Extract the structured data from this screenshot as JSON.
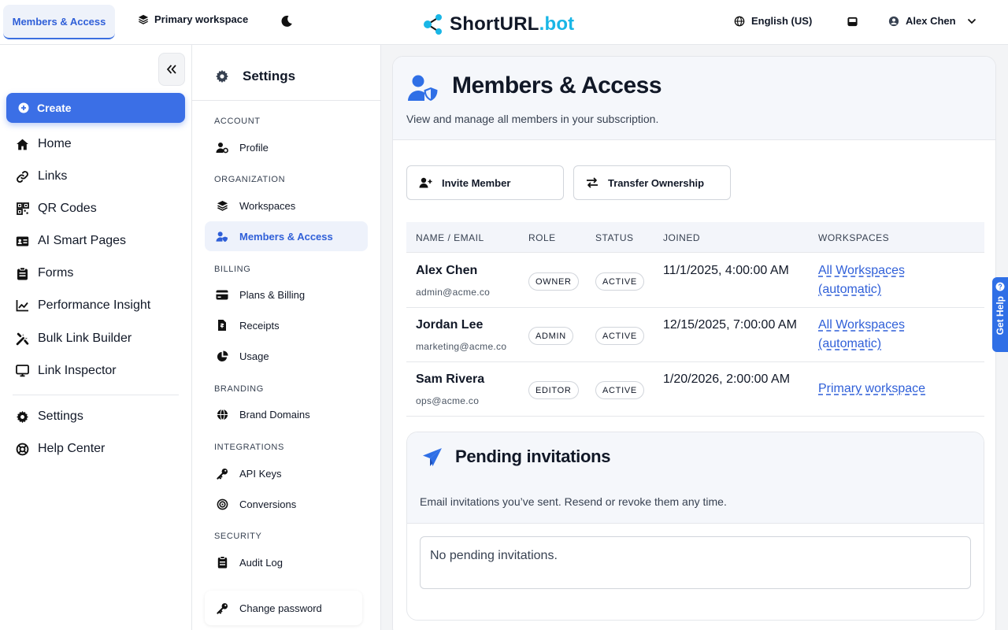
{
  "topbar": {
    "active_tab": "Members & Access",
    "workspace": "Primary workspace",
    "brand_main": "ShortURL",
    "brand_accent": ".bot",
    "language": "English (US)",
    "user": "Alex Chen"
  },
  "leftnav": {
    "create": "Create",
    "items": [
      {
        "label": "Home",
        "icon": "home-icon"
      },
      {
        "label": "Links",
        "icon": "link-icon"
      },
      {
        "label": "QR Codes",
        "icon": "qr-code-icon"
      },
      {
        "label": "AI Smart Pages",
        "icon": "id-card-icon"
      },
      {
        "label": "Forms",
        "icon": "clipboard-icon"
      },
      {
        "label": "Performance Insight",
        "icon": "chart-line-icon"
      },
      {
        "label": "Bulk Link Builder",
        "icon": "tools-icon"
      },
      {
        "label": "Link Inspector",
        "icon": "monitor-icon"
      }
    ],
    "bottom": [
      {
        "label": "Settings",
        "icon": "gear-icon"
      },
      {
        "label": "Help Center",
        "icon": "lifebuoy-icon"
      }
    ]
  },
  "settings": {
    "title": "Settings",
    "sections": {
      "account": "ACCOUNT",
      "organization": "ORGANIZATION",
      "billing": "BILLING",
      "branding": "BRANDING",
      "integrations": "INTEGRATIONS",
      "security": "SECURITY"
    },
    "items": {
      "profile": "Profile",
      "workspaces": "Workspaces",
      "members": "Members & Access",
      "plans": "Plans & Billing",
      "receipts": "Receipts",
      "usage": "Usage",
      "domains": "Brand Domains",
      "api": "API Keys",
      "conversions": "Conversions",
      "audit": "Audit Log",
      "password": "Change password"
    }
  },
  "main": {
    "title": "Members & Access",
    "subtitle": "View and manage all members in your subscription.",
    "invite": "Invite Member",
    "transfer": "Transfer Ownership",
    "columns": [
      "NAME / EMAIL",
      "ROLE",
      "STATUS",
      "JOINED",
      "WORKSPACES"
    ],
    "members": [
      {
        "name": "Alex Chen",
        "email": "admin@acme.co",
        "role": "OWNER",
        "status": "ACTIVE",
        "joined": "11/1/2025, 4:00:00 AM",
        "workspaces": "All Workspaces (automatic)"
      },
      {
        "name": "Jordan Lee",
        "email": "marketing@acme.co",
        "role": "ADMIN",
        "status": "ACTIVE",
        "joined": "12/15/2025, 7:00:00 AM",
        "workspaces": "All Workspaces (automatic)"
      },
      {
        "name": "Sam Rivera",
        "email": "ops@acme.co",
        "role": "EDITOR",
        "status": "ACTIVE",
        "joined": "1/20/2026, 2:00:00 AM",
        "workspaces": "Primary workspace"
      }
    ],
    "pending": {
      "title": "Pending invitations",
      "subtitle": "Email invitations you’ve sent. Resend or revoke them any time.",
      "empty": "No pending invitations."
    }
  },
  "help_tab": "Get Help",
  "colors": {
    "accent": "#3b6fe6",
    "brand_accent": "#19b6e6",
    "link": "#2f5fd8"
  }
}
